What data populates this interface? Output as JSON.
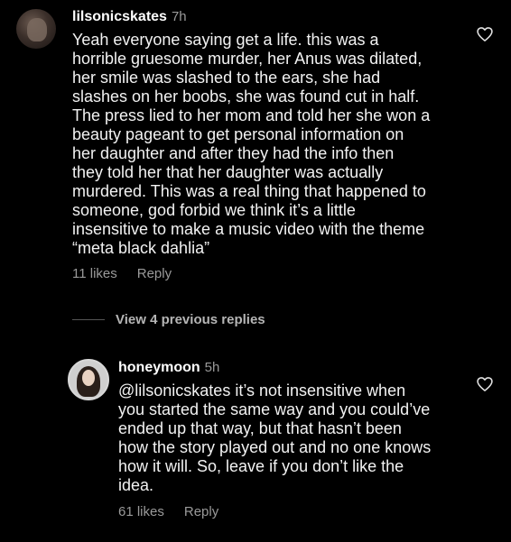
{
  "comments": [
    {
      "username": "lilsonicskates",
      "time": "7h",
      "text": "Yeah everyone saying get a life. this was a\nhorrible gruesome murder, her Anus was dilated,\nher smile was slashed to the ears, she had\nslashes on her boobs, she was found cut in half.\nThe press lied to her mom and told her she won a\nbeauty pageant to get personal information on\nher daughter and after they had the info then\nthey told her that her daughter was actually\nmurdered. This was a real thing that happened to\nsomeone, god forbid we think it’s a little\ninsensitive to make a music video with the theme\n“meta black dahlia”",
      "likes": "11 likes",
      "reply": "Reply"
    },
    {
      "username": "honeymoon",
      "time": "5h",
      "text": "@lilsonicskates it’s not insensitive when\nyou started the same way and you could’ve\nended up that way, but that hasn’t been\nhow the story played out and no one knows\nhow it will. So, leave if you don’t like the\nidea.",
      "likes": "61 likes",
      "reply": "Reply"
    }
  ],
  "view_previous": "View 4 previous replies",
  "colors": {
    "background": "#000000",
    "text": "#f2f2f2",
    "secondary": "#9a9a9a"
  },
  "icons": {
    "avatar": "avatar",
    "like": "heart-icon"
  }
}
